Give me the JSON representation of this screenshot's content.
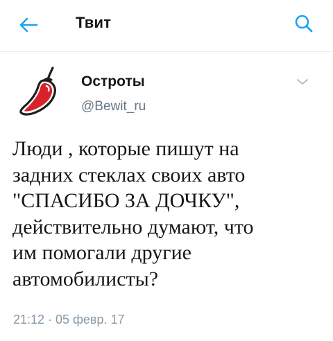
{
  "header": {
    "back_icon": "arrow-left-icon",
    "title": "Твит",
    "search_icon": "search-icon"
  },
  "tweet": {
    "author": {
      "name": "Остроты",
      "handle": "@Bewit_ru",
      "avatar": "red-chili-pepper"
    },
    "menu_icon": "chevron-down-icon",
    "text": "Люди , которые пишут на\nзадних стеклах своих авто\n\"СПАСИБО ЗА ДОЧКУ\",\nдействительно думают, что\nим помогали другие\nавтомобилисты?",
    "timestamp": "21:12 · 05 февр. 17"
  },
  "colors": {
    "accent": "#1da1f2",
    "text_primary": "#14171a",
    "text_secondary": "#657786",
    "divider": "#e6ecf0",
    "pepper_red": "#d8222a",
    "pepper_stem": "#1e1e1e"
  }
}
